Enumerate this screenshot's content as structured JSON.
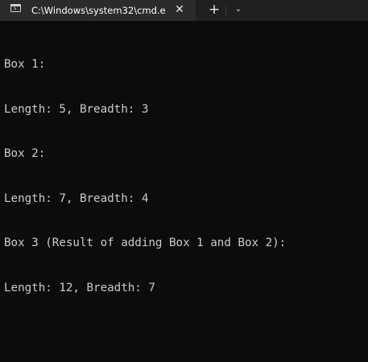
{
  "tab": {
    "title": "C:\\Windows\\system32\\cmd.e",
    "close_glyph": "✕",
    "icon": "terminal-icon"
  },
  "toolbar": {
    "new_tab_glyph": "+",
    "dropdown_glyph": "⌄"
  },
  "console": {
    "lines": [
      "Box 1:",
      "Length: 5, Breadth: 3",
      "Box 2:",
      "Length: 7, Breadth: 4",
      "Box 3 (Result of adding Box 1 and Box 2):",
      "Length: 12, Breadth: 7"
    ]
  },
  "colors": {
    "background": "#0c0c0c",
    "titlebar": "#202020",
    "active_tab": "#2b2b2b",
    "text": "#cccccc"
  }
}
